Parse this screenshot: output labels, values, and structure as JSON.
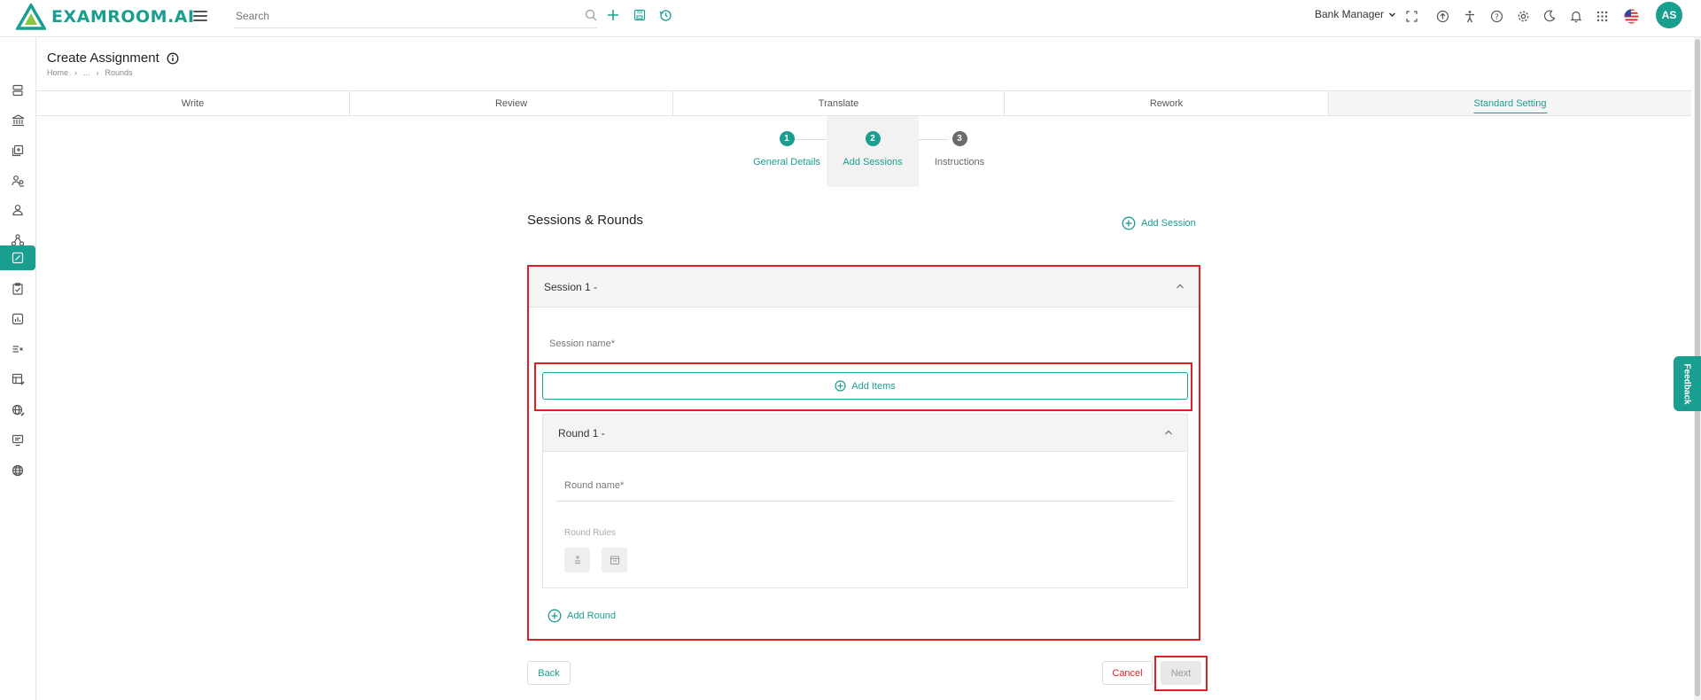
{
  "app": {
    "logo_text": "EXAMROOM.AI"
  },
  "header": {
    "search_placeholder": "Search",
    "role": "Bank Manager",
    "avatar_initials": "AS"
  },
  "page": {
    "title": "Create Assignment",
    "breadcrumb": [
      "Home",
      "...",
      "Rounds"
    ]
  },
  "tabs": [
    {
      "label": "Write"
    },
    {
      "label": "Review"
    },
    {
      "label": "Translate"
    },
    {
      "label": "Rework"
    },
    {
      "label": "Standard Setting",
      "active": true
    }
  ],
  "stepper": [
    {
      "number": "1",
      "label": "General Details",
      "state": "done"
    },
    {
      "number": "2",
      "label": "Add Sessions",
      "state": "current"
    },
    {
      "number": "3",
      "label": "Instructions",
      "state": "pending"
    }
  ],
  "sessions": {
    "title": "Sessions & Rounds",
    "add_session_label": "Add Session",
    "session_header": "Session 1 -",
    "session_name_label": "Session name*",
    "add_items_label": "Add Items",
    "round_header": "Round 1 -",
    "round_name_label": "Round name*",
    "round_rules_label": "Round Rules",
    "add_round_label": "Add Round"
  },
  "footer": {
    "back_label": "Back",
    "cancel_label": "Cancel",
    "next_label": "Next"
  },
  "feedback_label": "Feedback",
  "colors": {
    "accent": "#1a9e8f",
    "highlight": "#e01e26",
    "step_pending": "#6b6b6b"
  }
}
